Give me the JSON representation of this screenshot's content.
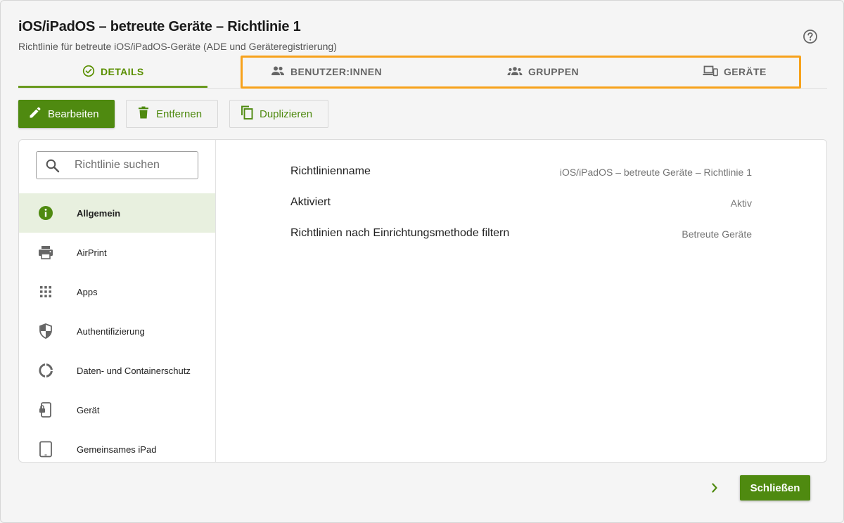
{
  "header": {
    "title": "iOS/iPadOS – betreute Geräte – Richtlinie 1",
    "subtitle": "Richtlinie für betreute iOS/iPadOS-Geräte (ADE und Geräteregistrierung)"
  },
  "tabs": [
    {
      "label": "DETAILS",
      "icon": "check-circle-icon",
      "active": true
    },
    {
      "label": "BENUTZER:INNEN",
      "icon": "users-icon",
      "active": false
    },
    {
      "label": "GRUPPEN",
      "icon": "groups-icon",
      "active": false
    },
    {
      "label": "GERÄTE",
      "icon": "devices-icon",
      "active": false
    }
  ],
  "toolbar": {
    "edit_label": "Bearbeiten",
    "remove_label": "Entfernen",
    "duplicate_label": "Duplizieren"
  },
  "search": {
    "placeholder": "Richtlinie suchen",
    "value": ""
  },
  "sidebar": {
    "items": [
      {
        "label": "Allgemein",
        "icon": "info-icon",
        "active": true
      },
      {
        "label": "AirPrint",
        "icon": "printer-icon",
        "active": false
      },
      {
        "label": "Apps",
        "icon": "apps-grid-icon",
        "active": false
      },
      {
        "label": "Authentifizierung",
        "icon": "shield-icon",
        "active": false
      },
      {
        "label": "Daten- und Containerschutz",
        "icon": "donut-icon",
        "active": false
      },
      {
        "label": "Gerät",
        "icon": "phone-lock-icon",
        "active": false
      },
      {
        "label": "Gemeinsames iPad",
        "icon": "tablet-icon",
        "active": false
      }
    ]
  },
  "details": [
    {
      "label": "Richtlinienname",
      "value": "iOS/iPadOS – betreute Geräte – Richtlinie 1"
    },
    {
      "label": "Aktiviert",
      "value": "Aktiv"
    },
    {
      "label": "Richtlinien nach Einrichtungsmethode filtern",
      "value": "Betreute Geräte"
    }
  ],
  "footer": {
    "close_label": "Schließen"
  },
  "colors": {
    "accent": "#4f8a10",
    "highlight": "#f7a21b",
    "active_bg": "#e8f0df"
  }
}
